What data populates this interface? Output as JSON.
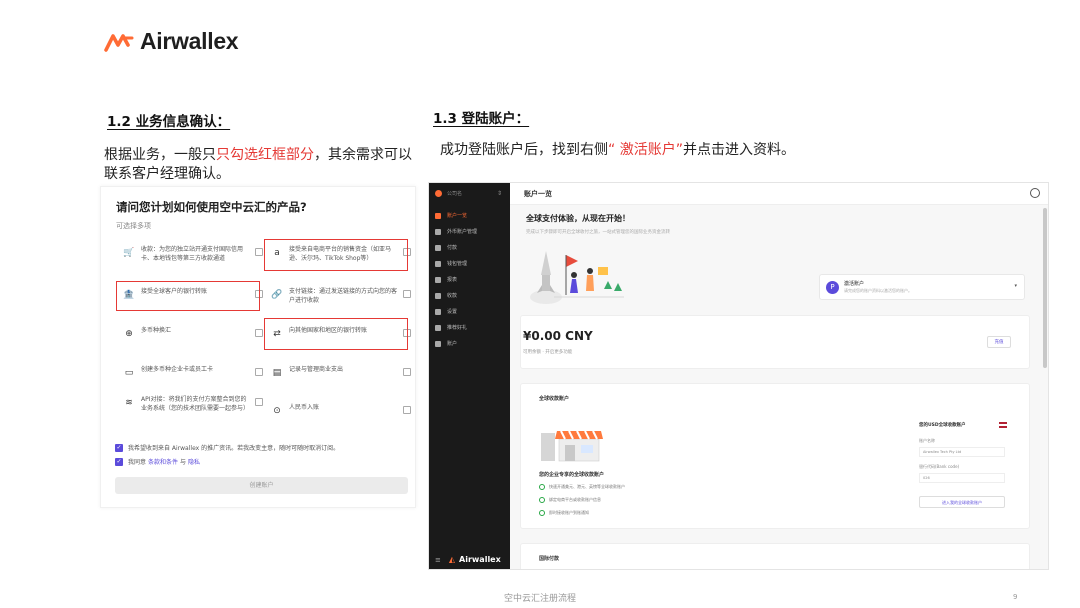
{
  "brand": {
    "name": "Airwallex",
    "accent": "#ff6b35"
  },
  "section_1_2": {
    "title": "1.2  业务信息确认：",
    "text_before": "根据业务，一般只",
    "text_highlight": "只勾选红框部分",
    "text_after": "，其余需求可以联系客户经理确认。"
  },
  "section_1_3": {
    "title": "1.3  登陆账户：",
    "text_before": "成功登陆账户后，找到右侧",
    "text_highlight": "“ 激活账户”",
    "text_after": "并点击进入资料。"
  },
  "form": {
    "title": "请问您计划如何使用空中云汇的产品?",
    "subtitle": "可选择多项",
    "options": [
      {
        "icon": "cart-icon",
        "glyph": "🛒",
        "text": "收款：为您的独立站开通支付国际信用卡、本地钱包等第三方收款通道",
        "highlighted": false
      },
      {
        "icon": "amazon-icon",
        "glyph": "a",
        "text": "接受来自电商平台的销售资金（如亚马逊、沃尔玛、TikTok Shop等）",
        "highlighted": true
      },
      {
        "icon": "bank-icon",
        "glyph": "🏦",
        "text": "接受全球客户的银行转账",
        "highlighted": true
      },
      {
        "icon": "link-icon",
        "glyph": "🔗",
        "text": "支付链接：通过发送链接的方式向您的客户进行收款",
        "highlighted": false
      },
      {
        "icon": "exchange-icon",
        "glyph": "⊕",
        "text": "多币种换汇",
        "highlighted": false
      },
      {
        "icon": "transfer-icon",
        "glyph": "⇄",
        "text": "向其他国家和地区的银行转账",
        "highlighted": true
      },
      {
        "icon": "card-icon",
        "glyph": "▭",
        "text": "创建多币种企业卡或员工卡",
        "highlighted": false
      },
      {
        "icon": "expense-icon",
        "glyph": "▤",
        "text": "记录与管理商业支出",
        "highlighted": false
      },
      {
        "icon": "api-icon",
        "glyph": "≋",
        "text": "API对接：将我们的支付方案整合到您的业务系统（您的技术团队需要一起参与）",
        "highlighted": false
      },
      {
        "icon": "rmb-icon",
        "glyph": "⊙",
        "text": "人民币入账",
        "highlighted": false
      }
    ],
    "consent_1": "我希望收到来自 Airwallex 的推广资讯。若我改变主意，随时可随时取消订阅。",
    "consent_2_prefix": "我同意",
    "consent_2_link_terms": "条款和条件",
    "consent_2_and": "与",
    "consent_2_link_privacy": "隐私",
    "submit_label": "创建账户"
  },
  "dashboard": {
    "org_name": "公司名",
    "sidebar": [
      {
        "label": "账户一览",
        "active": true
      },
      {
        "label": "外币账户管理"
      },
      {
        "label": "付款"
      },
      {
        "label": "钱包管理"
      },
      {
        "label": "报表"
      },
      {
        "label": "收款"
      },
      {
        "label": "设置"
      },
      {
        "label": "推荐好礼"
      },
      {
        "label": "账户"
      }
    ],
    "footer_brand": "Airwallex",
    "top_title": "账户一览",
    "hero_title": "全球支付体验，从现在开始！",
    "hero_sub": "完成以下步骤即可开启全球收付之旅，一站式管理您的国际业务资金流转",
    "activate_title": "激活账户",
    "activate_desc": "请完成您的账户资料以激活您的账户。",
    "balance": "¥0.00 CNY",
    "balance_sub": "可用余额 · 开启更多功能",
    "balance_btn": "充值",
    "global_title": "全球收款账户",
    "global_sub": "您的企业专享的全球收款账户",
    "global_items": [
      "快速开通美元、港元、英镑等全球收款账户",
      "绑定电商平台或收款账户信息",
      "即时接收账户到账通知"
    ],
    "acct_title": "您的USD全球收款账户",
    "acct_name_label": "账户名称",
    "acct_name_value": "Airwallex Tech Pty Ltd",
    "acct_bank_label": "银行代码(Bank code)",
    "acct_bank_value": "026",
    "acct_btn": "进入我的全球收款账户",
    "intl_title": "国际付款"
  },
  "footer": {
    "text": "空中云汇注册流程",
    "page": "9"
  }
}
